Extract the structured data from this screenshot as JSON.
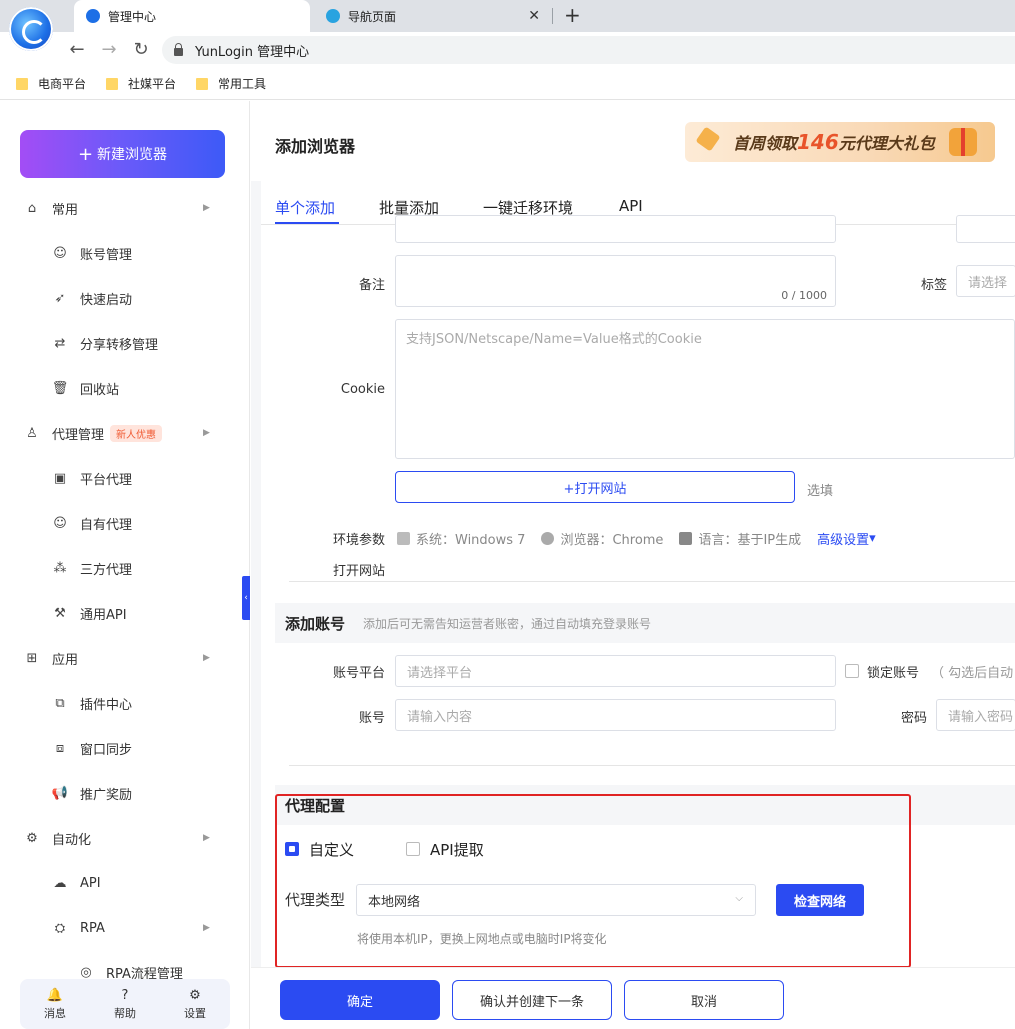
{
  "browser": {
    "tabs": [
      {
        "title": "管理中心",
        "active": true
      },
      {
        "title": "导航页面",
        "active": false
      }
    ],
    "address": "YunLogin 管理中心",
    "bookmarks": [
      "电商平台",
      "社媒平台",
      "常用工具"
    ]
  },
  "sidebar": {
    "new_button": "新建浏览器",
    "menu": {
      "common": "常用",
      "account_mgmt": "账号管理",
      "quick_start": "快速启动",
      "share_transfer": "分享转移管理",
      "recycle_bin": "回收站",
      "proxy_mgmt": "代理管理",
      "proxy_badge": "新人优惠",
      "platform_proxy": "平台代理",
      "own_proxy": "自有代理",
      "third_proxy": "三方代理",
      "general_api": "通用API",
      "apps": "应用",
      "plugin_center": "插件中心",
      "window_sync": "窗口同步",
      "promo_reward": "推广奖励",
      "automation": "自动化",
      "api": "API",
      "rpa": "RPA",
      "rpa_flow": "RPA流程管理"
    },
    "bottom": {
      "messages": "消息",
      "help": "帮助",
      "settings": "设置"
    }
  },
  "header": {
    "title": "添加浏览器",
    "promo": {
      "prefix": "首周领取",
      "amount": "146",
      "suffix": "元代理大礼包"
    }
  },
  "tabs": [
    "单个添加",
    "批量添加",
    "一键迁移环境",
    "API"
  ],
  "form": {
    "remark_label": "备注",
    "remark_counter": "0 / 1000",
    "tag_label": "标签",
    "tag_placeholder": "请选择",
    "cookie_label": "Cookie",
    "cookie_placeholder": "支持JSON/Netscape/Name=Value格式的Cookie",
    "open_site_label": "打开网站",
    "open_site_button": "+打开网站",
    "optional": "选填",
    "env_label": "环境参数",
    "env_system": "系统：Windows 7",
    "env_browser": "浏览器：Chrome",
    "env_language": "语言：基于IP生成",
    "advanced": "高级设置"
  },
  "account": {
    "title": "添加账号",
    "desc": "添加后可无需告知运营者账密，通过自动填充登录账号",
    "platform_label": "账号平台",
    "platform_placeholder": "请选择平台",
    "lock_label": "锁定账号",
    "lock_hint": "（ 勾选后自动",
    "account_label": "账号",
    "account_placeholder": "请输入内容",
    "password_label": "密码",
    "password_placeholder": "请输入密码"
  },
  "proxy": {
    "title": "代理配置",
    "option_custom": "自定义",
    "option_api": "API提取",
    "type_label": "代理类型",
    "type_value": "本地网络",
    "check_button": "检查网络",
    "note": "将使用本机IP，更换上网地点或电脑时IP将变化"
  },
  "footer": {
    "confirm": "确定",
    "confirm_next": "确认并创建下一条",
    "cancel": "取消"
  },
  "colors": {
    "accent": "#2b4bf2",
    "highlight_box": "#e02424"
  }
}
